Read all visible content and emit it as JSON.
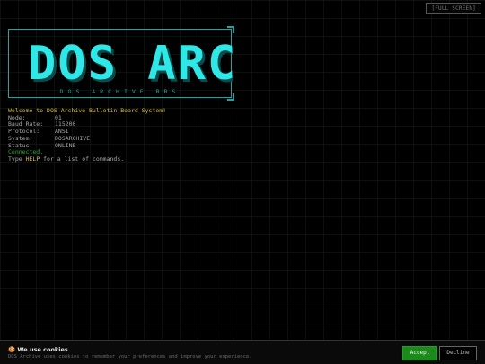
{
  "toolbar": {
    "fullscreen_label": "[FULL SCREEN]"
  },
  "logo": {
    "title": "DOS ARC",
    "subtitle": "DOS ARCHIVE BBS",
    "color": "#2ee8e8",
    "frame_color": "#1fa3a3"
  },
  "terminal": {
    "welcome": "Welcome to DOS Archive Bulletin Board System!",
    "info": [
      {
        "label": "Node:",
        "value": "01"
      },
      {
        "label": "Baud Rate:",
        "value": "115200"
      },
      {
        "label": "Protocol:",
        "value": "ANSI"
      },
      {
        "label": "System:",
        "value": "DOSARCHIVE"
      },
      {
        "label": "Status:",
        "value": "ONLINE"
      }
    ],
    "connected": "Connected.",
    "help_prefix": "Type ",
    "help_key": "HELP",
    "help_suffix": " for a list of commands."
  },
  "cookie": {
    "icon": "cookie-icon",
    "title": "We use cookies",
    "text": "DOS Archive uses cookies to remember your preferences and improve your experience.",
    "accept_label": "Accept",
    "decline_label": "Decline"
  },
  "colors": {
    "background": "#000000",
    "accent": "#2ee8e8",
    "welcome": "#d8c040",
    "connected": "#22b422",
    "accept": "#1a8a1a"
  }
}
